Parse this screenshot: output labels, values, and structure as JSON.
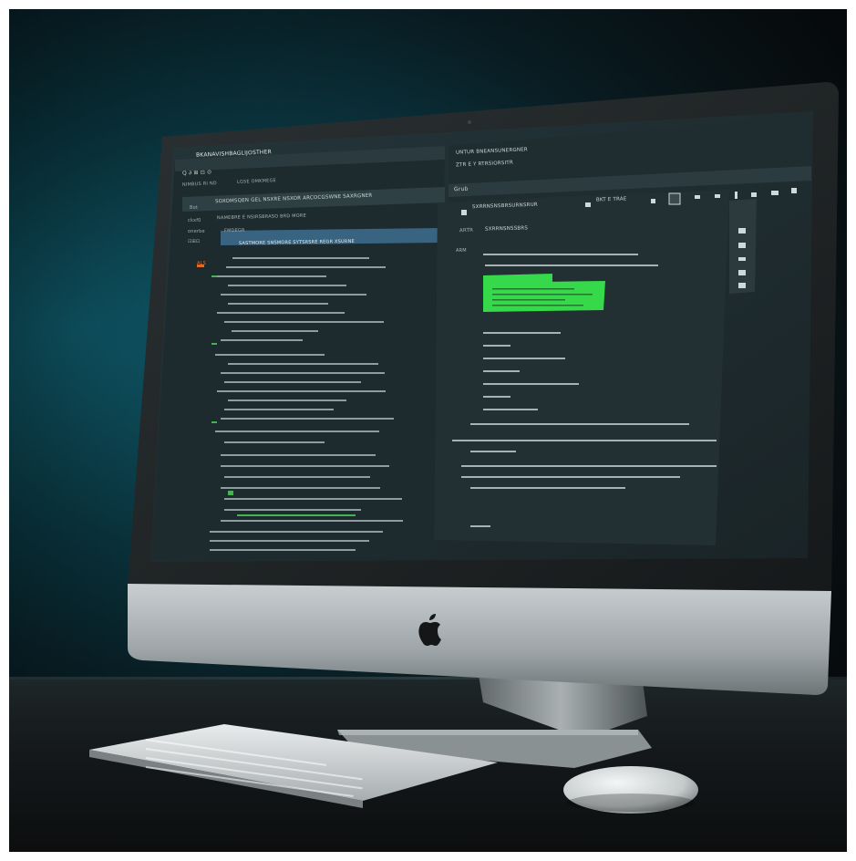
{
  "scene": {
    "subject": "desktop-computer-on-desk",
    "colors": {
      "background_teal": "#0f5b6b",
      "background_dark": "#0b1215",
      "screen_bg": "#1e2a2e",
      "highlight_green": "#35d94a",
      "selection_blue": "#3d6e8f",
      "chassis_silver": "#b9c0c2"
    }
  },
  "screen": {
    "left_panel": {
      "title": "BKANAVISHBAGLIJOSTHER",
      "search_label": "Q ∂ ⊞ ⊡ ⊙",
      "breadcrumb": "NIMBUS RI ND",
      "tab_label": "LGSE OMKMEGE",
      "sidebar_items": [
        "Bot",
        "ckxf0",
        "onerbe",
        "⊡⊞⊡ "
      ],
      "header_bar": "SOXOMSQEN GEL NSXRE NSXOR  ARCOCGSWNE  SAXRGNER",
      "subheader": "NAMEBRE  E NSIRSBRASO BRD MORE",
      "file_row": "FMDEGR",
      "selected_row": "SASTMORE SNSMORE  SYTSRSRE    REGR   XSURNE",
      "accent_label": "ALS"
    },
    "right_panel": {
      "top_text_1": "UNTUR    BNEANSUNERGNER",
      "top_text_2": "ZTR E  Y RTRSIORSITR",
      "tab_label": "Grub",
      "toolbar_title": "SXRRNSNSBRSURNSRUR",
      "toolbar_mid": "BKT E  TRAE",
      "row_label": "ARTR",
      "row_title": "SXRRNSNSSBRS",
      "line_prefix": "ARM"
    }
  }
}
